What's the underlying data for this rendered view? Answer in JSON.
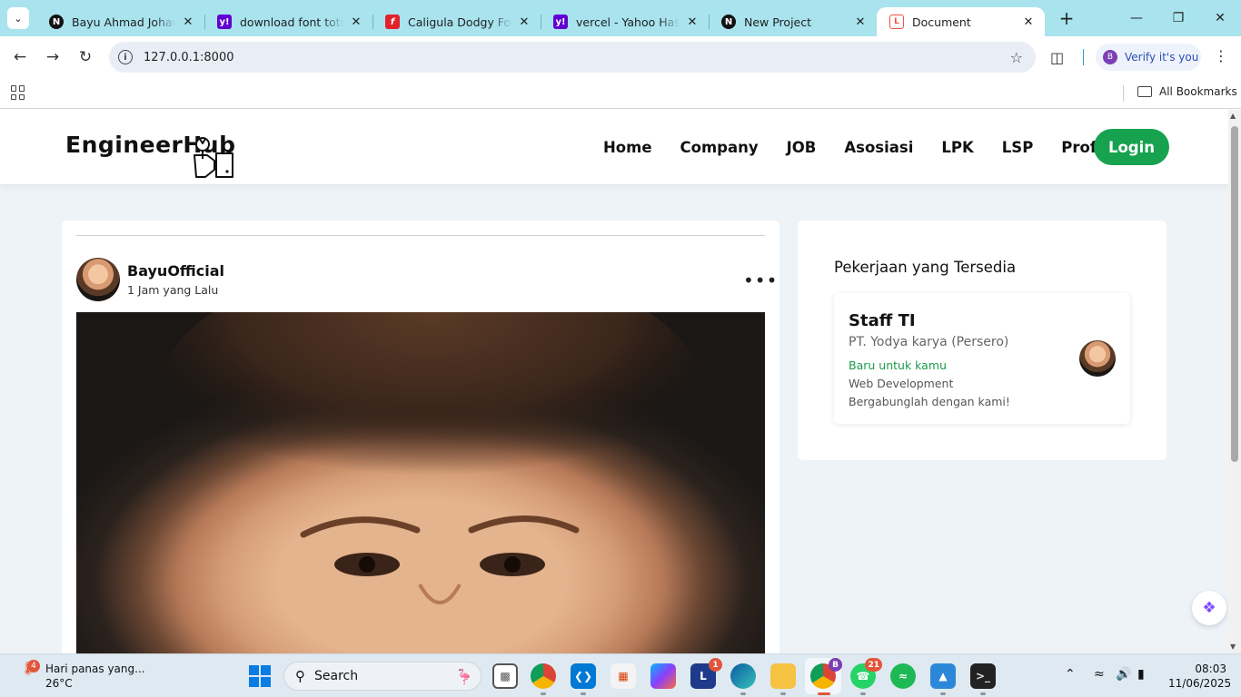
{
  "browser": {
    "tabs": [
      {
        "title": "Bayu Ahmad Johari -",
        "favicon": "nextjs-icon",
        "active": false
      },
      {
        "title": "download font totoro",
        "favicon": "yahoo-icon",
        "active": false
      },
      {
        "title": "Caligula Dodgy Font",
        "favicon": "fontspace-icon",
        "active": false
      },
      {
        "title": "vercel - Yahoo Hasil P",
        "favicon": "yahoo-icon",
        "active": false
      },
      {
        "title": "New Project",
        "favicon": "nextjs-icon",
        "active": false
      },
      {
        "title": "Document",
        "favicon": "laravel-icon",
        "active": true
      }
    ],
    "url": "127.0.0.1:8000",
    "verify_label": "Verify it's you",
    "profile_initial": "B",
    "bookmarks_label": "All Bookmarks"
  },
  "site": {
    "logo": "EngineerHub",
    "nav": [
      "Home",
      "Company",
      "JOB",
      "Asosiasi",
      "LPK",
      "LSP",
      "Profil"
    ],
    "login_label": "Login",
    "accent": "#17a24f"
  },
  "post": {
    "author": "BayuOfficial",
    "time": "1 Jam yang Lalu",
    "more_icon": "more-dots-icon"
  },
  "jobs": {
    "heading": "Pekerjaan yang Tersedia",
    "items": [
      {
        "title": "Staff TI",
        "company": "PT. Yodya karya (Persero)",
        "tag": "Baru untuk kamu",
        "field": "Web Development",
        "cta": "Bergabunglah dengan kami!"
      }
    ]
  },
  "taskbar": {
    "weather_text": "Hari panas yang...",
    "temperature": "26°C",
    "weather_badge": "4",
    "search_label": "Search",
    "badges": {
      "teams": "1",
      "chrome": "B",
      "whatsapp": "21"
    },
    "time": "08:03",
    "date": "11/06/2025"
  }
}
